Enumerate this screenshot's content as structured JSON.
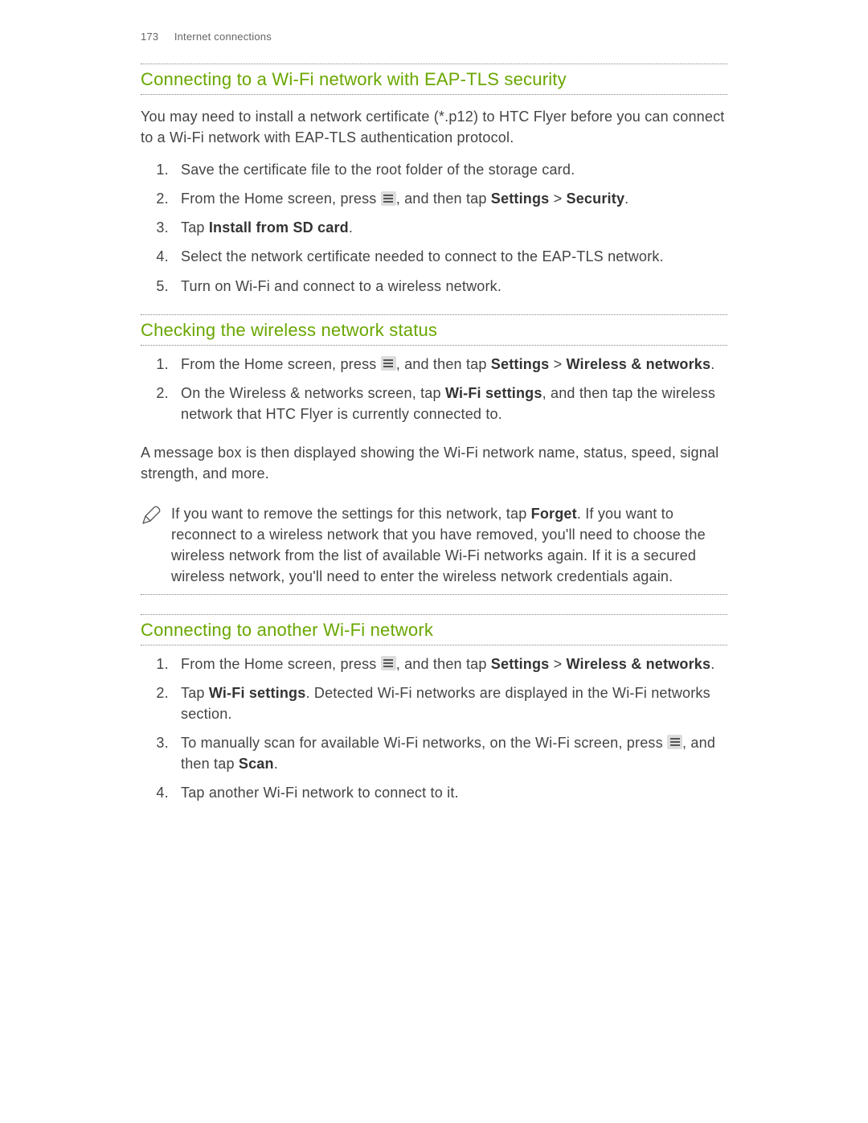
{
  "header": {
    "page_number": "173",
    "chapter": "Internet connections"
  },
  "sections": {
    "eap_tls": {
      "heading": "Connecting to a Wi‑Fi network with EAP‑TLS security",
      "intro": "You may need to install a network certificate (*.p12) to HTC Flyer before you can connect to a Wi‑Fi network with EAP‑TLS authentication protocol.",
      "steps": {
        "s1": "Save the certificate file to the root folder of the storage card.",
        "s2a": "From the Home screen, press ",
        "s2b": ", and then tap ",
        "s2c": "Settings",
        "s2d": " > ",
        "s2e": "Security",
        "s2f": ".",
        "s3a": "Tap ",
        "s3b": "Install from SD card",
        "s3c": ".",
        "s4": "Select the network certificate needed to connect to the EAP‑TLS network.",
        "s5": "Turn on Wi‑Fi and connect to a wireless network."
      }
    },
    "check_status": {
      "heading": "Checking the wireless network status",
      "steps": {
        "s1a": "From the Home screen, press ",
        "s1b": ", and then tap ",
        "s1c": "Settings",
        "s1d": " > ",
        "s1e": "Wireless & networks",
        "s1f": ".",
        "s2a": "On the Wireless & networks screen, tap ",
        "s2b": "Wi‑Fi settings",
        "s2c": ", and then tap the wireless network that HTC Flyer is currently connected to."
      },
      "result": "A message box is then displayed showing the Wi‑Fi network name, status, speed, signal strength, and more.",
      "note": {
        "a": "If you want to remove the settings for this network, tap ",
        "b": "Forget",
        "c": ". If you want to reconnect to a wireless network that you have removed, you'll need to choose the wireless network from the list of available Wi‑Fi networks again. If it is a secured wireless network, you'll need to enter the wireless network credentials again."
      }
    },
    "connect_other": {
      "heading": "Connecting to another Wi‑Fi network",
      "steps": {
        "s1a": "From the Home screen, press ",
        "s1b": ", and then tap ",
        "s1c": "Settings",
        "s1d": " > ",
        "s1e": "Wireless & networks",
        "s1f": ".",
        "s2a": "Tap ",
        "s2b": "Wi‑Fi settings",
        "s2c": ". Detected Wi‑Fi networks are displayed in the Wi‑Fi networks section.",
        "s3a": "To manually scan for available Wi‑Fi networks, on the Wi‑Fi screen, press ",
        "s3b": ", and then tap ",
        "s3c": "Scan",
        "s3d": ".",
        "s4": "Tap another Wi‑Fi network to connect to it."
      }
    }
  }
}
